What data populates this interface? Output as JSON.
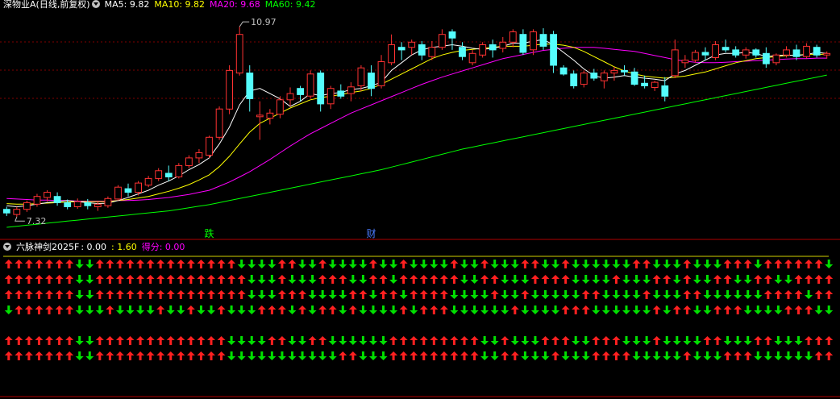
{
  "main_panel": {
    "title": "深物业A(日线,前复权)",
    "ma_labels": [
      {
        "text": "MA5: 9.82",
        "color": "#ffffff"
      },
      {
        "text": "MA10: 9.82",
        "color": "#ffff00"
      },
      {
        "text": "MA20: 9.68",
        "color": "#ff00ff"
      },
      {
        "text": "MA60: 9.42",
        "color": "#00ff00"
      }
    ],
    "high_label": "10.97",
    "low_label": "7.32",
    "markers": [
      {
        "text": "跌",
        "color": "#00ff00",
        "index": 20
      },
      {
        "text": "财",
        "color": "#4a7bff",
        "index": 36
      }
    ]
  },
  "sub_panel": {
    "title": "六脉神剑2025F",
    "values": [
      {
        "text": ": 0.00",
        "color": "#ffffff"
      },
      {
        "text": ": 1.60",
        "color": "#ffff00"
      },
      {
        "text": "得分: 0.00",
        "color": "#ff00ff"
      }
    ]
  },
  "colors": {
    "up": "#ff3232",
    "down": "#54fcfc",
    "ma5": "#ffffff",
    "ma10": "#ffff00",
    "ma20": "#ff00ff",
    "ma60": "#00ff00",
    "arrow_up": "#ff2020",
    "arrow_down": "#00e000",
    "grid": "#7f0000"
  },
  "chart_data": {
    "type": "candlestick",
    "ylim": [
      7.1,
      11.3
    ],
    "ohlc": [
      [
        7.45,
        7.5,
        7.32,
        7.38
      ],
      [
        7.35,
        7.5,
        7.3,
        7.45
      ],
      [
        7.45,
        7.62,
        7.4,
        7.58
      ],
      [
        7.55,
        7.75,
        7.5,
        7.7
      ],
      [
        7.68,
        7.82,
        7.6,
        7.78
      ],
      [
        7.7,
        7.78,
        7.52,
        7.58
      ],
      [
        7.58,
        7.64,
        7.45,
        7.5
      ],
      [
        7.5,
        7.66,
        7.46,
        7.6
      ],
      [
        7.58,
        7.65,
        7.45,
        7.52
      ],
      [
        7.5,
        7.6,
        7.42,
        7.55
      ],
      [
        7.52,
        7.7,
        7.48,
        7.66
      ],
      [
        7.65,
        7.92,
        7.62,
        7.88
      ],
      [
        7.85,
        7.95,
        7.7,
        7.78
      ],
      [
        7.78,
        8.0,
        7.72,
        7.96
      ],
      [
        7.92,
        8.1,
        7.88,
        8.05
      ],
      [
        8.05,
        8.25,
        8.0,
        8.2
      ],
      [
        8.15,
        8.3,
        8.0,
        8.08
      ],
      [
        8.08,
        8.35,
        8.05,
        8.3
      ],
      [
        8.3,
        8.5,
        8.25,
        8.45
      ],
      [
        8.45,
        8.62,
        8.35,
        8.55
      ],
      [
        8.5,
        8.88,
        8.45,
        8.85
      ],
      [
        8.85,
        9.45,
        8.8,
        9.4
      ],
      [
        9.4,
        10.25,
        9.3,
        10.15
      ],
      [
        10.1,
        11.0,
        10.05,
        10.85
      ],
      [
        10.1,
        10.25,
        9.35,
        9.6
      ],
      [
        9.25,
        9.55,
        8.8,
        9.28
      ],
      [
        9.22,
        9.4,
        9.1,
        9.32
      ],
      [
        9.3,
        9.65,
        9.22,
        9.58
      ],
      [
        9.58,
        9.82,
        9.45,
        9.7
      ],
      [
        9.8,
        9.85,
        9.55,
        9.68
      ],
      [
        9.65,
        10.15,
        9.6,
        10.08
      ],
      [
        10.1,
        10.15,
        9.35,
        9.5
      ],
      [
        9.5,
        9.85,
        9.4,
        9.8
      ],
      [
        9.75,
        9.88,
        9.6,
        9.65
      ],
      [
        9.7,
        9.92,
        9.55,
        9.83
      ],
      [
        9.85,
        10.25,
        9.75,
        10.2
      ],
      [
        10.1,
        10.25,
        9.65,
        9.8
      ],
      [
        9.85,
        10.45,
        9.8,
        10.32
      ],
      [
        10.3,
        10.85,
        10.25,
        10.65
      ],
      [
        10.6,
        10.7,
        10.35,
        10.55
      ],
      [
        10.6,
        10.75,
        10.45,
        10.7
      ],
      [
        10.65,
        10.72,
        10.35,
        10.45
      ],
      [
        10.42,
        10.72,
        10.35,
        10.6
      ],
      [
        10.6,
        10.95,
        10.55,
        10.85
      ],
      [
        10.9,
        10.95,
        10.55,
        10.78
      ],
      [
        10.6,
        10.7,
        10.35,
        10.42
      ],
      [
        10.3,
        10.55,
        10.25,
        10.48
      ],
      [
        10.45,
        10.7,
        10.4,
        10.65
      ],
      [
        10.65,
        10.75,
        10.4,
        10.55
      ],
      [
        10.58,
        10.8,
        10.5,
        10.7
      ],
      [
        10.7,
        10.95,
        10.6,
        10.9
      ],
      [
        10.85,
        10.95,
        10.45,
        10.5
      ],
      [
        10.55,
        10.95,
        10.45,
        10.9
      ],
      [
        10.85,
        10.97,
        10.55,
        10.62
      ],
      [
        10.85,
        10.92,
        10.1,
        10.25
      ],
      [
        10.2,
        10.25,
        10.05,
        10.08
      ],
      [
        10.08,
        10.15,
        9.8,
        9.85
      ],
      [
        9.88,
        10.15,
        9.82,
        10.1
      ],
      [
        10.1,
        10.18,
        9.95,
        10.0
      ],
      [
        9.95,
        10.15,
        9.8,
        10.1
      ],
      [
        10.1,
        10.22,
        9.95,
        10.15
      ],
      [
        10.15,
        10.25,
        10.05,
        10.12
      ],
      [
        10.12,
        10.2,
        9.85,
        9.88
      ],
      [
        9.9,
        10.05,
        9.8,
        9.85
      ],
      [
        9.82,
        9.95,
        9.75,
        9.92
      ],
      [
        9.85,
        10.02,
        9.55,
        9.65
      ],
      [
        10.05,
        10.75,
        10.0,
        10.55
      ],
      [
        10.3,
        10.45,
        10.2,
        10.35
      ],
      [
        10.35,
        10.55,
        10.3,
        10.5
      ],
      [
        10.5,
        10.6,
        10.35,
        10.45
      ],
      [
        10.4,
        10.72,
        10.35,
        10.65
      ],
      [
        10.6,
        10.75,
        10.5,
        10.55
      ],
      [
        10.55,
        10.62,
        10.4,
        10.45
      ],
      [
        10.45,
        10.6,
        10.38,
        10.55
      ],
      [
        10.55,
        10.58,
        10.4,
        10.45
      ],
      [
        10.48,
        10.6,
        10.2,
        10.28
      ],
      [
        10.3,
        10.48,
        10.25,
        10.45
      ],
      [
        10.45,
        10.62,
        10.4,
        10.55
      ],
      [
        10.55,
        10.65,
        10.35,
        10.42
      ],
      [
        10.42,
        10.68,
        10.38,
        10.62
      ],
      [
        10.6,
        10.65,
        10.4,
        10.45
      ],
      [
        10.45,
        10.52,
        10.38,
        10.48
      ]
    ],
    "ma5": [
      7.52,
      7.5,
      7.52,
      7.55,
      7.58,
      7.6,
      7.62,
      7.6,
      7.58,
      7.56,
      7.57,
      7.62,
      7.68,
      7.75,
      7.82,
      7.92,
      8.0,
      8.1,
      8.22,
      8.32,
      8.45,
      8.72,
      9.05,
      9.48,
      9.75,
      9.8,
      9.7,
      9.6,
      9.45,
      9.55,
      9.7,
      9.66,
      9.7,
      9.72,
      9.78,
      9.8,
      9.85,
      9.92,
      10.15,
      10.3,
      10.45,
      10.55,
      10.6,
      10.62,
      10.65,
      10.62,
      10.58,
      10.56,
      10.58,
      10.62,
      10.68,
      10.68,
      10.72,
      10.75,
      10.65,
      10.5,
      10.35,
      10.18,
      10.05,
      10.0,
      10.02,
      10.05,
      10.02,
      10.0,
      9.98,
      9.95,
      10.08,
      10.15,
      10.25,
      10.35,
      10.45,
      10.48,
      10.48,
      10.5,
      10.48,
      10.42,
      10.44,
      10.45,
      10.44,
      10.46,
      10.5,
      10.48
    ],
    "ma10": [
      7.56,
      7.55,
      7.55,
      7.56,
      7.57,
      7.58,
      7.59,
      7.6,
      7.6,
      7.6,
      7.6,
      7.62,
      7.64,
      7.67,
      7.7,
      7.75,
      7.8,
      7.86,
      7.93,
      8.02,
      8.12,
      8.28,
      8.48,
      8.72,
      8.95,
      9.12,
      9.22,
      9.32,
      9.42,
      9.5,
      9.58,
      9.62,
      9.65,
      9.68,
      9.72,
      9.75,
      9.8,
      9.88,
      9.98,
      10.08,
      10.18,
      10.28,
      10.38,
      10.45,
      10.5,
      10.54,
      10.56,
      10.58,
      10.6,
      10.62,
      10.62,
      10.62,
      10.64,
      10.66,
      10.66,
      10.64,
      10.6,
      10.52,
      10.42,
      10.32,
      10.22,
      10.14,
      10.08,
      10.04,
      10.02,
      10.0,
      10.02,
      10.04,
      10.08,
      10.12,
      10.18,
      10.24,
      10.3,
      10.34,
      10.38,
      10.4,
      10.42,
      10.44,
      10.45,
      10.46,
      10.46,
      10.47
    ],
    "ma20": [
      7.66,
      7.65,
      7.64,
      7.63,
      7.63,
      7.62,
      7.62,
      7.61,
      7.61,
      7.61,
      7.61,
      7.62,
      7.62,
      7.63,
      7.64,
      7.66,
      7.68,
      7.71,
      7.74,
      7.78,
      7.82,
      7.9,
      7.98,
      8.08,
      8.18,
      8.3,
      8.42,
      8.55,
      8.68,
      8.8,
      8.92,
      9.02,
      9.12,
      9.22,
      9.32,
      9.4,
      9.48,
      9.56,
      9.64,
      9.72,
      9.8,
      9.88,
      9.95,
      10.02,
      10.08,
      10.14,
      10.2,
      10.26,
      10.32,
      10.38,
      10.42,
      10.46,
      10.5,
      10.54,
      10.56,
      10.58,
      10.6,
      10.6,
      10.6,
      10.58,
      10.56,
      10.54,
      10.52,
      10.48,
      10.44,
      10.4,
      10.36,
      10.33,
      10.31,
      10.3,
      10.3,
      10.31,
      10.32,
      10.33,
      10.34,
      10.35,
      10.36,
      10.37,
      10.38,
      10.38,
      10.39,
      10.39
    ],
    "ma60": [
      7.1,
      7.12,
      7.14,
      7.16,
      7.18,
      7.2,
      7.22,
      7.24,
      7.26,
      7.28,
      7.3,
      7.32,
      7.34,
      7.36,
      7.38,
      7.4,
      7.42,
      7.45,
      7.48,
      7.51,
      7.54,
      7.58,
      7.62,
      7.66,
      7.7,
      7.74,
      7.78,
      7.82,
      7.86,
      7.9,
      7.94,
      7.98,
      8.02,
      8.06,
      8.1,
      8.14,
      8.18,
      8.22,
      8.27,
      8.32,
      8.37,
      8.42,
      8.47,
      8.52,
      8.57,
      8.62,
      8.66,
      8.7,
      8.74,
      8.78,
      8.82,
      8.86,
      8.9,
      8.94,
      8.98,
      9.02,
      9.06,
      9.1,
      9.14,
      9.18,
      9.22,
      9.26,
      9.3,
      9.34,
      9.38,
      9.42,
      9.46,
      9.5,
      9.54,
      9.58,
      9.62,
      9.66,
      9.7,
      9.74,
      9.78,
      9.82,
      9.86,
      9.9,
      9.94,
      9.98,
      10.02,
      10.06
    ],
    "signals": [
      "UUUUUUUDDUUUUUUUUUUUUUUDDDDUUDDUDDDDUDDUDDDDUDDUDDDUUDDUDDDDDDUUDDDUDDDUUUDUUUUUUDDUUUUD",
      "UUUUUUUDDUUUUUUUUUUUUUUUDDDUDDDUUUDDUUDUUUUUUDDUUDDDUUUUDDDDUDDDUUDUDDUUDDUUDDUUUUDDUUDD",
      "UUUUUUUDDUUUUUUUUUUUUUUUDDDUUUDDDDUUDUUDUUUUDDDDUDDUDDDDDUUDDDDUDDDUUDDDDDDUUUUDUUUUDDDD",
      "DUUUUUUDDDUDDDDUDDUDDUDDDUUUDUDUUDUDDDDUDUUUDDDDDDUDDDDUUUDDDDDDUDUUDDUUUDDDDUUUDDDDUUUDD",
      "",
      "UUUUUUUDDUUUUUUUUUUUUUDDDDUUDDUUDDDDDDUUUUUUUUUDDUDDDUUUDDUUUDDDUDDDDUUDDDUUDDDUUUUDDUUDD",
      "UUUUUUUDDUUUUUUUUUUUUUDDDDDDDDDDDUUDDDUUUUUUUUUDDUUDDDUDDDUUUUDDDDDUDDDUUUDDDDDDUUUUUUUDD"
    ]
  }
}
